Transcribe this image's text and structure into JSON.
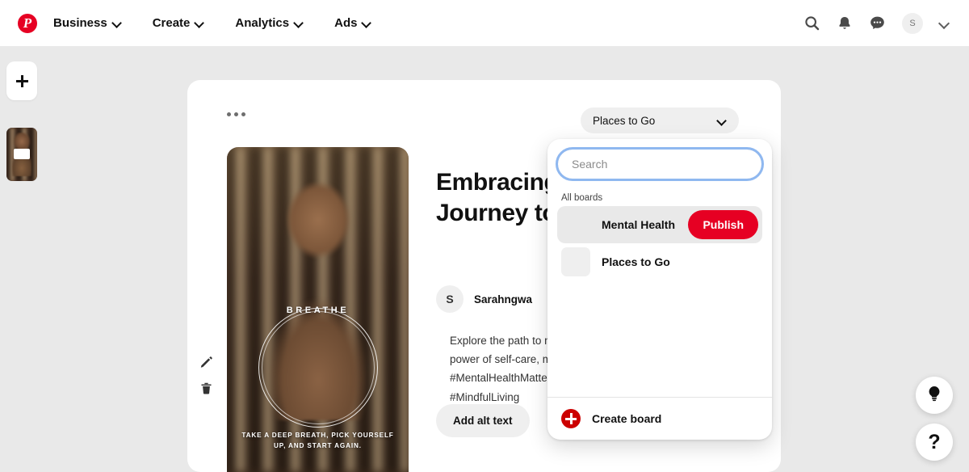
{
  "header": {
    "logo_icon": "pinterest-logo-icon",
    "nav": [
      {
        "label": "Business",
        "icon": "chevron-down-icon"
      },
      {
        "label": "Create",
        "icon": "chevron-down-icon"
      },
      {
        "label": "Analytics",
        "icon": "chevron-down-icon"
      },
      {
        "label": "Ads",
        "icon": "chevron-down-icon"
      }
    ],
    "actions": {
      "search_icon": "search-icon",
      "notifications_icon": "bell-icon",
      "messages_icon": "chat-bubble-icon",
      "avatar_initial": "S",
      "account_chevron_icon": "chevron-down-icon"
    }
  },
  "rail": {
    "add_label": "+",
    "add_icon": "plus-icon",
    "thumb_name": "pin-thumbnail"
  },
  "card": {
    "overflow_icon": "more-options-icon",
    "media": {
      "overlay_text": "BREATHE",
      "caption": "TAKE A DEEP BREATH, PICK YOURSELF UP, AND START AGAIN.",
      "edit_icon": "pencil-icon",
      "delete_icon": "trash-icon"
    },
    "pin": {
      "title": "Embracing Well-Being: A Journey to Harmony",
      "author_initial": "S",
      "author_name": "Sarahngwa",
      "description": "Explore the path to mental wellness and discover the power of self-care, mindfulness, and resilience. #MentalHealthMatters #SelfCareJourney #MindfulLiving",
      "alt_text_button": "Add alt text"
    }
  },
  "board_select": {
    "value": "Places to Go",
    "chevron_icon": "chevron-down-icon"
  },
  "dropdown": {
    "search_placeholder": "Search",
    "search_value": "",
    "section_label": "All boards",
    "boards": [
      {
        "name": "Mental Health",
        "active": true,
        "action_label": "Publish"
      },
      {
        "name": "Places to Go",
        "active": false,
        "action_label": ""
      }
    ],
    "footer": {
      "label": "Create board",
      "icon": "plus-circle-icon"
    }
  },
  "fabs": [
    {
      "name": "tips-button",
      "icon": "lightbulb-icon"
    },
    {
      "name": "help-button",
      "icon": "question-mark-icon",
      "glyph": "?"
    }
  ],
  "colors": {
    "brand_red": "#e60023",
    "create_board_red": "#cc0000",
    "page_bg": "#e9e9e9",
    "focus_ring": "#8fb8f0"
  }
}
